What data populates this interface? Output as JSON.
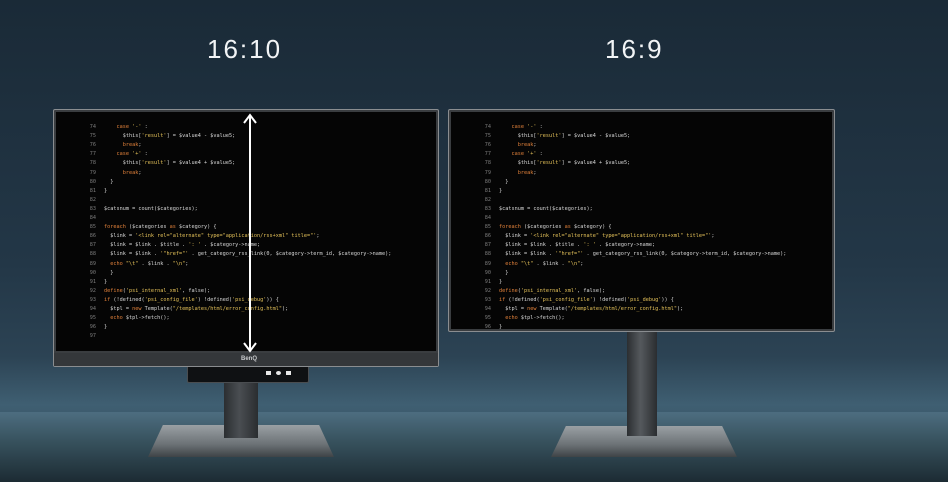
{
  "labels": {
    "left": "16:10",
    "right": "16:9"
  },
  "brand": "BenQ",
  "code": [
    {
      "n": "74",
      "t": "    case '-' :"
    },
    {
      "n": "75",
      "t": "      $this['result'] = $value4 - $value5;"
    },
    {
      "n": "76",
      "t": "      break;"
    },
    {
      "n": "77",
      "t": "    case '+' :"
    },
    {
      "n": "78",
      "t": "      $this['result'] = $value4 + $value5;"
    },
    {
      "n": "79",
      "t": "      break;"
    },
    {
      "n": "80",
      "t": "  }"
    },
    {
      "n": "81",
      "t": "}"
    },
    {
      "n": "82",
      "t": ""
    },
    {
      "n": "83",
      "t": "$catsnum = count($categories);"
    },
    {
      "n": "84",
      "t": ""
    },
    {
      "n": "85",
      "t": "foreach ($categories as $category) {"
    },
    {
      "n": "86",
      "t": "  $link = '<link rel=\"alternate\" type=\"application/rss+xml\" title=\"';"
    },
    {
      "n": "87",
      "t": "  $link = $link . $title . ': ' . $category->name;"
    },
    {
      "n": "88",
      "t": "  $link = $link . '\"href=\"' . get_category_rss_link(0, $category->term_id, $category->name);"
    },
    {
      "n": "89",
      "t": "  echo \"\\t\" . $link . \"\\n\";"
    },
    {
      "n": "90",
      "t": "  }"
    },
    {
      "n": "91",
      "t": "}"
    },
    {
      "n": "92",
      "t": "define('psi_internal_xml', false);"
    },
    {
      "n": "93",
      "t": "if (!defined('psi_config_file') !defined('psi_debug')) {"
    },
    {
      "n": "94",
      "t": "  $tpl = new Template(\"/templates/html/error_config.html\");"
    },
    {
      "n": "95",
      "t": "  echo $tpl->fetch();"
    },
    {
      "n": "96",
      "t": "}"
    },
    {
      "n": "97",
      "t": ""
    }
  ],
  "colors": {
    "keyword": "#e0803a",
    "string": "#e6c35a",
    "text": "#d8d8d8",
    "line_number": "#7c7c7c"
  }
}
